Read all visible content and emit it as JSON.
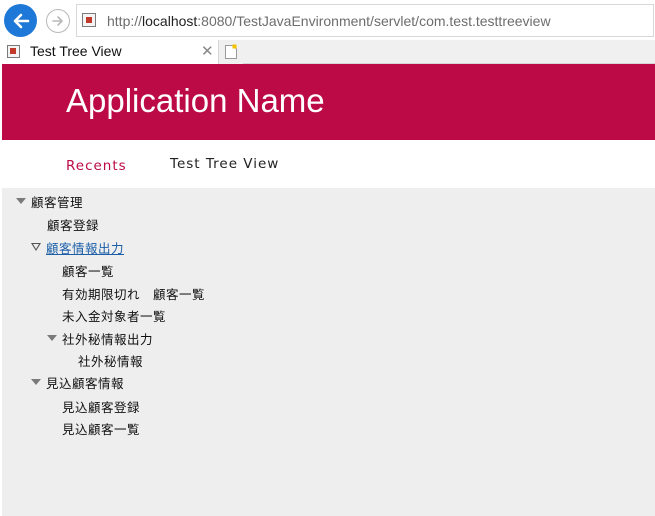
{
  "browser": {
    "url_prefix": "http://",
    "url_host": "localhost",
    "url_rest": ":8080/TestJavaEnvironment/servlet/com.test.testtreeview",
    "tab_title": "Test Tree View",
    "tab_close": "✕",
    "back_icon": "back-arrow-icon",
    "forward_icon": "forward-arrow-icon",
    "accent": "#1e78d7"
  },
  "app": {
    "title": "Application Name",
    "brand_color": "#bc0a46"
  },
  "nav": {
    "recents": "Recents",
    "tree_view": "Test Tree View"
  },
  "tree": {
    "n1": {
      "label": "顧客管理",
      "expanded": true
    },
    "n1_1": {
      "label": "顧客登録"
    },
    "n1_2": {
      "label": "顧客情報出力",
      "expanded": true,
      "link": true
    },
    "n1_2_1": {
      "label": "顧客一覧"
    },
    "n1_2_2": {
      "label": "有効期限切れ　顧客一覧"
    },
    "n1_2_3": {
      "label": "未入金対象者一覧"
    },
    "n1_2_4": {
      "label": "社外秘情報出力",
      "expanded": true
    },
    "n1_2_4_1": {
      "label": "社外秘情報"
    },
    "n2": {
      "label": "見込顧客情報",
      "expanded": true
    },
    "n2_1": {
      "label": "見込顧客登録"
    },
    "n2_2": {
      "label": "見込顧客一覧"
    }
  }
}
